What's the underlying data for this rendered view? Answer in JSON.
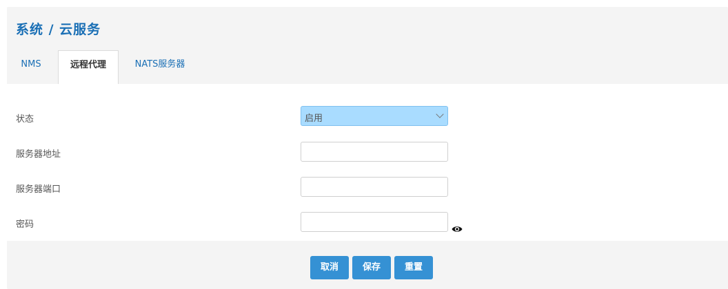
{
  "page": {
    "title": "系统 / 云服务"
  },
  "tabs": [
    {
      "label": "NMS"
    },
    {
      "label": "远程代理"
    },
    {
      "label": "NATS服务器"
    }
  ],
  "form": {
    "status": {
      "label": "状态",
      "value": "启用"
    },
    "server_address": {
      "label": "服务器地址",
      "value": ""
    },
    "server_port": {
      "label": "服务器端口",
      "value": ""
    },
    "password": {
      "label": "密码",
      "value": ""
    }
  },
  "buttons": {
    "cancel": "取消",
    "save": "保存",
    "reset": "重置"
  },
  "colors": {
    "accent": "#1a6fb5",
    "button": "#3591d4",
    "select_bg": "#a9dcff"
  },
  "icons": {
    "password_toggle": "eye-icon",
    "select_arrow": "chevron-down-icon"
  }
}
